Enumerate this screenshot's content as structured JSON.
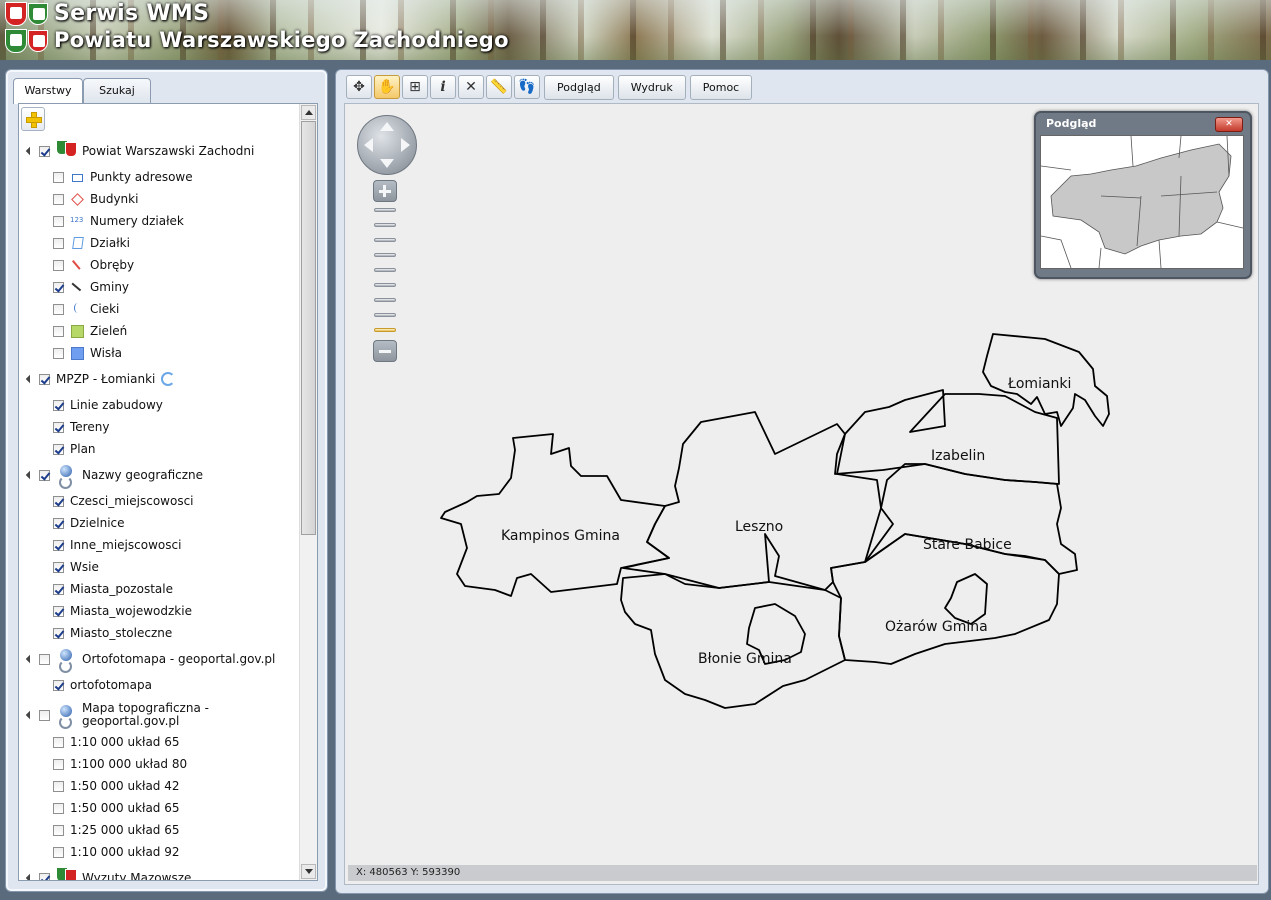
{
  "header": {
    "title_line1": "Serwis WMS",
    "title_line2": "Powiatu Warszawskiego Zachodniego"
  },
  "left_panel": {
    "tabs": [
      {
        "label": "Warstwy",
        "active": true
      },
      {
        "label": "Szukaj",
        "active": false
      }
    ],
    "groups": [
      {
        "label": "Powiat Warszawski Zachodni",
        "icon": "crest-icon",
        "checked": true,
        "layers": [
          {
            "label": "Punkty adresowe",
            "checked": false,
            "icon": "envelope-icon"
          },
          {
            "label": "Budynki",
            "checked": false,
            "icon": "diamond-icon"
          },
          {
            "label": "Numery działek",
            "checked": false,
            "icon": "parcel-number-icon"
          },
          {
            "label": "Działki",
            "checked": false,
            "icon": "parcel-icon"
          },
          {
            "label": "Obręby",
            "checked": false,
            "icon": "line-red-icon"
          },
          {
            "label": "Gminy",
            "checked": true,
            "icon": "line-black-icon"
          },
          {
            "label": "Cieki",
            "checked": false,
            "icon": "stream-icon"
          },
          {
            "label": "Zieleń",
            "checked": false,
            "icon": "green-square-icon"
          },
          {
            "label": "Wisła",
            "checked": false,
            "icon": "blue-square-icon"
          }
        ]
      },
      {
        "label": "MPZP - Łomianki",
        "icon": "loading-icon",
        "checked": true,
        "layers": [
          {
            "label": "Linie zabudowy",
            "checked": true
          },
          {
            "label": "Tereny",
            "checked": true
          },
          {
            "label": "Plan",
            "checked": true
          }
        ]
      },
      {
        "label": "Nazwy geograficzne",
        "icon": "globe-icon",
        "checked": true,
        "layers": [
          {
            "label": "Czesci_miejscowosci",
            "checked": true
          },
          {
            "label": "Dzielnice",
            "checked": true
          },
          {
            "label": "Inne_miejscowosci",
            "checked": true
          },
          {
            "label": "Wsie",
            "checked": true
          },
          {
            "label": "Miasta_pozostale",
            "checked": true
          },
          {
            "label": "Miasta_wojewodzkie",
            "checked": true
          },
          {
            "label": "Miasto_stoleczne",
            "checked": true
          }
        ]
      },
      {
        "label": "Ortofotomapa - geoportal.gov.pl",
        "icon": "globe-icon",
        "checked": false,
        "layers": [
          {
            "label": "ortofotomapa",
            "checked": true
          }
        ]
      },
      {
        "label_line1": "Mapa topograficzna -",
        "label_line2": "geoportal.gov.pl",
        "icon": "globe-icon",
        "checked": false,
        "layers": [
          {
            "label": "1:10 000 układ 65",
            "checked": false
          },
          {
            "label": "1:100 000 układ 80",
            "checked": false
          },
          {
            "label": "1:50 000 układ 42",
            "checked": false
          },
          {
            "label": "1:50 000 układ 65",
            "checked": false
          },
          {
            "label": "1:25 000 układ 65",
            "checked": false
          },
          {
            "label": "1:10 000 układ 92",
            "checked": false
          }
        ]
      },
      {
        "label": "Wyzuty Mazowsze",
        "icon": "crest-icon",
        "checked": true,
        "partially_visible": true
      }
    ]
  },
  "toolbar": {
    "icon_buttons": [
      {
        "name": "pan-arrows-icon",
        "glyph": "✥",
        "active": false
      },
      {
        "name": "hand-icon",
        "glyph": "✋",
        "active": true
      },
      {
        "name": "zoom-box-icon",
        "glyph": "⊞",
        "active": false
      },
      {
        "name": "info-icon",
        "glyph": "i",
        "active": false
      },
      {
        "name": "tools-icon",
        "glyph": "✕",
        "active": false
      },
      {
        "name": "ruler-icon",
        "glyph": "📏",
        "active": false
      },
      {
        "name": "footprints-icon",
        "glyph": "👣",
        "active": false
      }
    ],
    "text_buttons": [
      "Podgląd",
      "Wydruk",
      "Pomoc"
    ]
  },
  "map": {
    "background_color": "#eeeeee",
    "zoom_levels": 9,
    "selected_zoom_level": 9,
    "labels": [
      "Łomianki",
      "Izabelin",
      "Kampinos Gmina",
      "Leszno",
      "Stare Babice",
      "Ożarów Gmina",
      "Błonie Gmina"
    ],
    "status": "X: 480563 Y: 593390"
  },
  "overview": {
    "title": "Podgląd",
    "close_label": "✕"
  }
}
